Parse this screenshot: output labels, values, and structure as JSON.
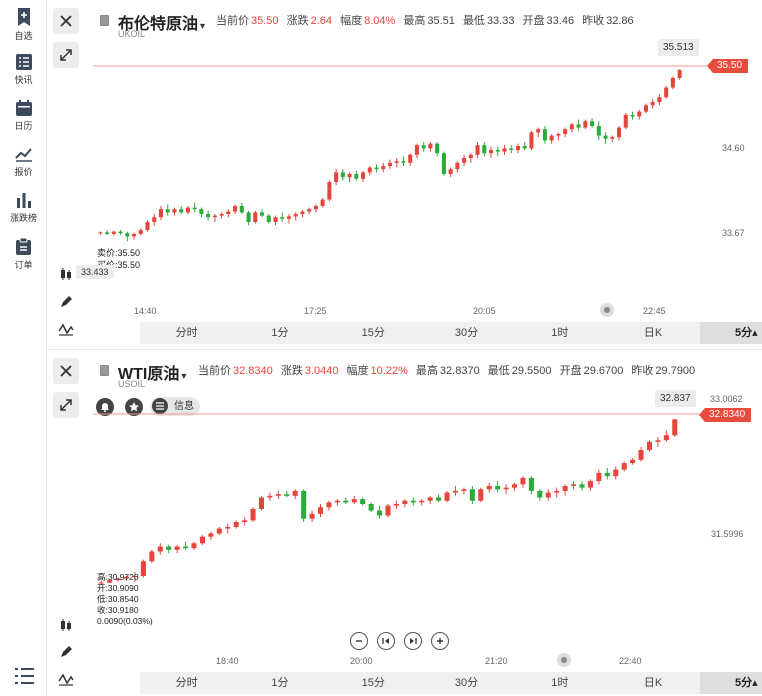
{
  "sidebar": {
    "items": [
      {
        "label": "自选",
        "icon": "bookmark-plus-icon"
      },
      {
        "label": "快讯",
        "icon": "news-list-icon"
      },
      {
        "label": "日历",
        "icon": "calendar-icon"
      },
      {
        "label": "报价",
        "icon": "line-chart-icon"
      },
      {
        "label": "涨跌榜",
        "icon": "bar-chart-icon"
      },
      {
        "label": "订单",
        "icon": "clipboard-icon"
      }
    ]
  },
  "panel1": {
    "title": "布伦特原油",
    "code": "UKOIL",
    "stats": {
      "cur_label": "当前价",
      "cur": "35.50",
      "chg_label": "涨跌",
      "chg": "2.64",
      "amp_label": "幅度",
      "amp": "8.04%",
      "high_label": "最高",
      "high": "35.51",
      "low_label": "最低",
      "low": "33.33",
      "open_label": "开盘",
      "open": "33.46",
      "prev_label": "昨收",
      "prev": "32.86"
    },
    "price_tag": "35.50",
    "peak_label": "35.513",
    "left_label": "33.433",
    "y_labels": [
      "34.60",
      "33.67"
    ],
    "x_labels": [
      "14:40",
      "17:25",
      "20:05",
      "22:45"
    ],
    "sell": "卖价:35.50",
    "buy": "买价:35.50",
    "timeframes": [
      "分时",
      "1分",
      "15分",
      "30分",
      "1时",
      "日K",
      "5分▴"
    ],
    "accent": "#e74c3c",
    "chart_data": {
      "type": "candlestick",
      "title": "",
      "x": [
        "14:40",
        "17:25",
        "20:05",
        "22:45"
      ],
      "ylim": [
        33.3,
        35.55
      ],
      "candles": [
        [
          33.46,
          33.48,
          33.44,
          33.47
        ],
        [
          33.47,
          33.5,
          33.44,
          33.45
        ],
        [
          33.45,
          33.49,
          33.43,
          33.48
        ],
        [
          33.48,
          33.5,
          33.44,
          33.46
        ],
        [
          33.46,
          33.48,
          33.36,
          33.42
        ],
        [
          33.42,
          33.46,
          33.38,
          33.45
        ],
        [
          33.45,
          33.52,
          33.43,
          33.5
        ],
        [
          33.5,
          33.62,
          33.48,
          33.6
        ],
        [
          33.6,
          33.7,
          33.55,
          33.66
        ],
        [
          33.66,
          33.8,
          33.62,
          33.76
        ],
        [
          33.76,
          33.82,
          33.68,
          33.72
        ],
        [
          33.72,
          33.78,
          33.68,
          33.76
        ],
        [
          33.76,
          33.8,
          33.7,
          33.72
        ],
        [
          33.72,
          33.8,
          33.7,
          33.78
        ],
        [
          33.78,
          33.84,
          33.72,
          33.76
        ],
        [
          33.76,
          33.78,
          33.66,
          33.7
        ],
        [
          33.7,
          33.74,
          33.62,
          33.66
        ],
        [
          33.66,
          33.7,
          33.6,
          33.68
        ],
        [
          33.68,
          33.72,
          33.64,
          33.7
        ],
        [
          33.7,
          33.76,
          33.66,
          33.73
        ],
        [
          33.73,
          33.82,
          33.7,
          33.8
        ],
        [
          33.8,
          33.84,
          33.7,
          33.72
        ],
        [
          33.72,
          33.74,
          33.56,
          33.6
        ],
        [
          33.6,
          33.74,
          33.58,
          33.72
        ],
        [
          33.72,
          33.76,
          33.66,
          33.68
        ],
        [
          33.68,
          33.7,
          33.58,
          33.6
        ],
        [
          33.6,
          33.68,
          33.56,
          33.66
        ],
        [
          33.66,
          33.72,
          33.6,
          33.64
        ],
        [
          33.64,
          33.7,
          33.58,
          33.67
        ],
        [
          33.67,
          33.72,
          33.62,
          33.7
        ],
        [
          33.7,
          33.75,
          33.66,
          33.73
        ],
        [
          33.73,
          33.78,
          33.7,
          33.76
        ],
        [
          33.76,
          33.82,
          33.72,
          33.8
        ],
        [
          33.8,
          33.9,
          33.78,
          33.88
        ],
        [
          33.88,
          34.12,
          33.86,
          34.1
        ],
        [
          34.1,
          34.26,
          34.06,
          34.22
        ],
        [
          34.22,
          34.26,
          34.12,
          34.16
        ],
        [
          34.16,
          34.22,
          34.1,
          34.2
        ],
        [
          34.2,
          34.24,
          34.12,
          34.14
        ],
        [
          34.14,
          34.24,
          34.1,
          34.22
        ],
        [
          34.22,
          34.3,
          34.18,
          34.28
        ],
        [
          34.28,
          34.32,
          34.22,
          34.26
        ],
        [
          34.26,
          34.34,
          34.22,
          34.3
        ],
        [
          34.3,
          34.38,
          34.26,
          34.34
        ],
        [
          34.34,
          34.4,
          34.28,
          34.36
        ],
        [
          34.36,
          34.42,
          34.3,
          34.34
        ],
        [
          34.34,
          34.46,
          34.3,
          34.44
        ],
        [
          34.44,
          34.58,
          34.4,
          34.56
        ],
        [
          34.56,
          34.6,
          34.48,
          34.52
        ],
        [
          34.52,
          34.6,
          34.48,
          34.58
        ],
        [
          34.58,
          34.6,
          34.42,
          34.46
        ],
        [
          34.46,
          34.48,
          34.18,
          34.2
        ],
        [
          34.2,
          34.28,
          34.16,
          34.26
        ],
        [
          34.26,
          34.36,
          34.22,
          34.34
        ],
        [
          34.34,
          34.44,
          34.3,
          34.4
        ],
        [
          34.4,
          34.46,
          34.34,
          34.44
        ],
        [
          34.44,
          34.6,
          34.4,
          34.56
        ],
        [
          34.56,
          34.6,
          34.42,
          34.46
        ],
        [
          34.46,
          34.54,
          34.4,
          34.5
        ],
        [
          34.5,
          34.54,
          34.42,
          34.48
        ],
        [
          34.48,
          34.56,
          34.44,
          34.52
        ],
        [
          34.52,
          34.56,
          34.46,
          34.5
        ],
        [
          34.5,
          34.58,
          34.46,
          34.55
        ],
        [
          34.55,
          34.6,
          34.5,
          34.52
        ],
        [
          34.52,
          34.74,
          34.5,
          34.72
        ],
        [
          34.72,
          34.78,
          34.66,
          34.76
        ],
        [
          34.76,
          34.8,
          34.58,
          34.62
        ],
        [
          34.62,
          34.7,
          34.58,
          34.68
        ],
        [
          34.68,
          34.72,
          34.62,
          34.7
        ],
        [
          34.7,
          34.78,
          34.66,
          34.76
        ],
        [
          34.76,
          34.84,
          34.72,
          34.82
        ],
        [
          34.82,
          34.88,
          34.74,
          34.78
        ],
        [
          34.78,
          34.88,
          34.76,
          34.86
        ],
        [
          34.86,
          34.9,
          34.78,
          34.8
        ],
        [
          34.8,
          34.86,
          34.62,
          34.68
        ],
        [
          34.68,
          34.72,
          34.58,
          34.64
        ],
        [
          34.64,
          34.68,
          34.6,
          34.66
        ],
        [
          34.66,
          34.8,
          34.62,
          34.78
        ],
        [
          34.78,
          34.96,
          34.76,
          34.94
        ],
        [
          34.94,
          34.98,
          34.88,
          34.92
        ],
        [
          34.92,
          35.0,
          34.88,
          34.98
        ],
        [
          34.98,
          35.08,
          34.96,
          35.06
        ],
        [
          35.06,
          35.14,
          35.02,
          35.1
        ],
        [
          35.1,
          35.2,
          35.06,
          35.16
        ],
        [
          35.16,
          35.3,
          35.14,
          35.28
        ],
        [
          35.28,
          35.42,
          35.26,
          35.4
        ],
        [
          35.4,
          35.51,
          35.38,
          35.5
        ]
      ]
    }
  },
  "panel2": {
    "title": "WTI原油",
    "code": "USOIL",
    "stats": {
      "cur_label": "当前价",
      "cur": "32.8340",
      "chg_label": "涨跌",
      "chg": "3.0440",
      "amp_label": "幅度",
      "amp": "10.22%",
      "high_label": "最高",
      "high": "32.8370",
      "low_label": "最低",
      "low": "29.5500",
      "open_label": "开盘",
      "open": "29.6700",
      "prev_label": "昨收",
      "prev": "29.7900"
    },
    "info_label": "信息",
    "price_tag": "32.8340",
    "peak_label": "32.837",
    "y_labels": [
      "33.0062",
      "31.5996"
    ],
    "x_labels": [
      "18:40",
      "20:00",
      "21:20",
      "22:40"
    ],
    "ohlc": [
      "高:30.9720",
      "开:30.9090",
      "低:30.8540",
      "收:30.9180",
      "0.0090(0.03%)"
    ],
    "timeframes": [
      "分时",
      "1分",
      "15分",
      "30分",
      "1时",
      "日K",
      "5分▴"
    ],
    "chart_data": {
      "type": "candlestick",
      "title": "",
      "x": [
        "18:40",
        "20:00",
        "21:20",
        "22:40"
      ],
      "ylim": [
        30.7,
        32.9
      ],
      "candles": [
        [
          30.83,
          30.86,
          30.81,
          30.84
        ],
        [
          30.84,
          30.88,
          30.83,
          30.87
        ],
        [
          30.87,
          30.9,
          30.85,
          30.89
        ],
        [
          30.89,
          30.92,
          30.86,
          30.91
        ],
        [
          30.91,
          30.97,
          30.85,
          30.92
        ],
        [
          30.92,
          31.12,
          30.9,
          31.1
        ],
        [
          31.1,
          31.24,
          31.08,
          31.22
        ],
        [
          31.22,
          31.32,
          31.18,
          31.28
        ],
        [
          31.28,
          31.3,
          31.2,
          31.24
        ],
        [
          31.24,
          31.3,
          31.2,
          31.28
        ],
        [
          31.28,
          31.34,
          31.24,
          31.26
        ],
        [
          31.26,
          31.34,
          31.24,
          31.32
        ],
        [
          31.32,
          31.42,
          31.3,
          31.4
        ],
        [
          31.4,
          31.46,
          31.36,
          31.44
        ],
        [
          31.44,
          31.52,
          31.42,
          31.5
        ],
        [
          31.5,
          31.56,
          31.44,
          31.52
        ],
        [
          31.52,
          31.6,
          31.5,
          31.58
        ],
        [
          31.58,
          31.64,
          31.54,
          31.6
        ],
        [
          31.6,
          31.76,
          31.58,
          31.74
        ],
        [
          31.74,
          31.9,
          31.72,
          31.88
        ],
        [
          31.88,
          31.94,
          31.84,
          31.9
        ],
        [
          31.9,
          31.96,
          31.86,
          31.92
        ],
        [
          31.92,
          31.96,
          31.88,
          31.9
        ],
        [
          31.9,
          31.98,
          31.86,
          31.96
        ],
        [
          31.96,
          31.98,
          31.58,
          31.62
        ],
        [
          31.62,
          31.72,
          31.58,
          31.68
        ],
        [
          31.68,
          31.8,
          31.64,
          31.76
        ],
        [
          31.76,
          31.84,
          31.72,
          31.82
        ],
        [
          31.82,
          31.86,
          31.78,
          31.84
        ],
        [
          31.84,
          31.88,
          31.8,
          31.82
        ],
        [
          31.82,
          31.9,
          31.8,
          31.86
        ],
        [
          31.86,
          31.88,
          31.78,
          31.8
        ],
        [
          31.8,
          31.82,
          31.7,
          31.72
        ],
        [
          31.72,
          31.78,
          31.62,
          31.66
        ],
        [
          31.66,
          31.8,
          31.64,
          31.78
        ],
        [
          31.78,
          31.84,
          31.74,
          31.8
        ],
        [
          31.8,
          31.86,
          31.76,
          31.84
        ],
        [
          31.84,
          31.88,
          31.78,
          31.82
        ],
        [
          31.82,
          31.86,
          31.78,
          31.84
        ],
        [
          31.84,
          31.9,
          31.8,
          31.88
        ],
        [
          31.88,
          31.92,
          31.82,
          31.84
        ],
        [
          31.84,
          31.96,
          31.82,
          31.94
        ],
        [
          31.94,
          32.02,
          31.9,
          31.96
        ],
        [
          31.96,
          32.0,
          31.92,
          31.98
        ],
        [
          31.98,
          32.02,
          31.8,
          31.84
        ],
        [
          31.84,
          32.0,
          31.82,
          31.98
        ],
        [
          31.98,
          32.06,
          31.94,
          32.02
        ],
        [
          32.02,
          32.08,
          31.94,
          31.98
        ],
        [
          31.98,
          32.04,
          31.92,
          32.0
        ],
        [
          32.0,
          32.06,
          31.96,
          32.04
        ],
        [
          32.04,
          32.14,
          32.0,
          32.12
        ],
        [
          32.12,
          32.14,
          31.92,
          31.96
        ],
        [
          31.96,
          31.98,
          31.84,
          31.88
        ],
        [
          31.88,
          31.98,
          31.84,
          31.94
        ],
        [
          31.94,
          32.0,
          31.88,
          31.96
        ],
        [
          31.96,
          32.04,
          31.9,
          32.02
        ],
        [
          32.02,
          32.08,
          31.98,
          32.04
        ],
        [
          32.04,
          32.08,
          31.96,
          32.0
        ],
        [
          32.0,
          32.1,
          31.96,
          32.08
        ],
        [
          32.08,
          32.22,
          32.04,
          32.18
        ],
        [
          32.18,
          32.24,
          32.1,
          32.14
        ],
        [
          32.14,
          32.26,
          32.1,
          32.22
        ],
        [
          32.22,
          32.32,
          32.2,
          32.3
        ],
        [
          32.3,
          32.36,
          32.28,
          32.34
        ],
        [
          32.34,
          32.5,
          32.32,
          32.46
        ],
        [
          32.46,
          32.58,
          32.44,
          32.56
        ],
        [
          32.56,
          32.62,
          32.5,
          32.58
        ],
        [
          32.58,
          32.7,
          32.56,
          32.64
        ],
        [
          32.64,
          32.84,
          32.62,
          32.834
        ]
      ]
    }
  }
}
